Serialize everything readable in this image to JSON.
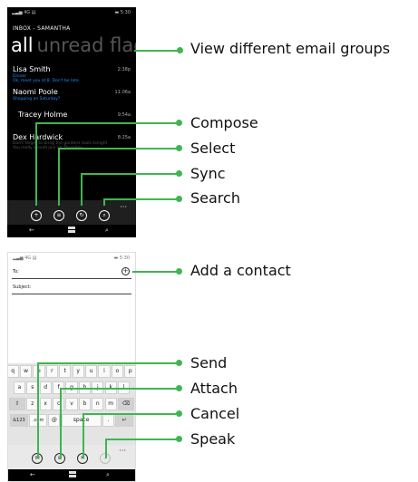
{
  "phone1": {
    "status_left": "▂▃▅ 4G ▤",
    "status_right": "▬ 5:30",
    "inbox_title": "INBOX - SAMANTHA",
    "pivots": {
      "active": "all",
      "others": "unread flagg"
    },
    "emails": [
      {
        "from": "Lisa Smith",
        "time": "2:38p",
        "subject": "Dinner",
        "preview": "Ok, meet you at 8. Don't be late.",
        "highlight": true
      },
      {
        "from": "Naomi Poole",
        "time": "11:06a",
        "subject": "Shopping on Saturday?",
        "preview": "",
        "highlight": true
      },
      {
        "from": "Tracey Holme",
        "time": "9:54a",
        "subject": "",
        "preview": "",
        "highlight": false
      },
      {
        "from": "Dex Hardwick",
        "time": "8:25a",
        "subject": "Don't forget to bring the gardens tools tonight",
        "preview": "You really should join on Thursday...",
        "highlight": false
      }
    ],
    "appbar": {
      "more": "···"
    },
    "nav": {
      "back": "←",
      "search": "⌕"
    }
  },
  "phone2": {
    "status_left": "▂▃▅ 4G ▤",
    "status_right": "▬ 5:30",
    "to_label": "To:",
    "subject_label": "Subject:",
    "keyboard_rows": [
      [
        "q",
        "w",
        "e",
        "r",
        "t",
        "y",
        "u",
        "i",
        "o",
        "p"
      ],
      [
        "a",
        "s",
        "d",
        "f",
        "g",
        "h",
        "j",
        "k",
        "l"
      ],
      [
        "⇧",
        "z",
        "x",
        "c",
        "v",
        "b",
        "n",
        "m",
        "⌫"
      ],
      [
        "&123",
        ".com",
        "@",
        "space",
        ".",
        "↵"
      ]
    ],
    "appbar": {
      "more": "···"
    },
    "nav": {
      "back": "←",
      "search": "⌕"
    }
  },
  "callouts": [
    {
      "label": "View different email groups"
    },
    {
      "label": "Compose"
    },
    {
      "label": "Select"
    },
    {
      "label": "Sync"
    },
    {
      "label": "Search"
    },
    {
      "label": "Add a contact"
    },
    {
      "label": "Send"
    },
    {
      "label": "Attach"
    },
    {
      "label": "Cancel"
    },
    {
      "label": "Speak"
    }
  ],
  "colors": {
    "callout": "#3eb650",
    "link_blue": "#1e8fff"
  }
}
